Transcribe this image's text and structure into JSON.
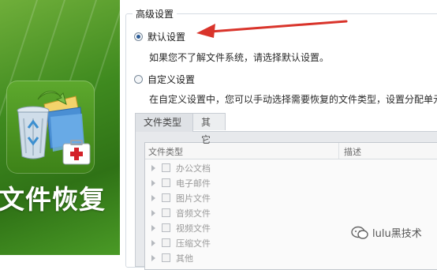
{
  "app": {
    "title": "文件恢复"
  },
  "settings": {
    "group_title": "高级设置",
    "default_option": {
      "label": "默认设置",
      "description": "如果您不了解文件系统，请选择默认设置。",
      "selected": true
    },
    "custom_option": {
      "label": "自定义设置",
      "description": "在自定义设置中，您可以手动选择需要恢复的文件类型，设置分配单元",
      "selected": false
    }
  },
  "tabs": [
    {
      "label": "文件类型",
      "active": true
    },
    {
      "label": "其它",
      "active": false
    }
  ],
  "file_list": {
    "columns": [
      "文件类型",
      "描述"
    ],
    "items": [
      {
        "label": "办公文档",
        "checked": false
      },
      {
        "label": "电子邮件",
        "checked": false
      },
      {
        "label": "图片文件",
        "checked": false
      },
      {
        "label": "音频文件",
        "checked": false
      },
      {
        "label": "视频文件",
        "checked": false
      },
      {
        "label": "压缩文件",
        "checked": false
      },
      {
        "label": "其他",
        "checked": false
      }
    ]
  },
  "watermark": {
    "text": "lulu黑技术"
  },
  "colors": {
    "banner_green": "#3f8a1f",
    "annotation_arrow": "#d9342b",
    "radio_selected": "#2b5b96"
  },
  "icons": [
    "recycle-bin-icon",
    "folder-restore-icon",
    "first-aid-kit-icon",
    "arrow-annotation-icon",
    "wechat-icon"
  ]
}
